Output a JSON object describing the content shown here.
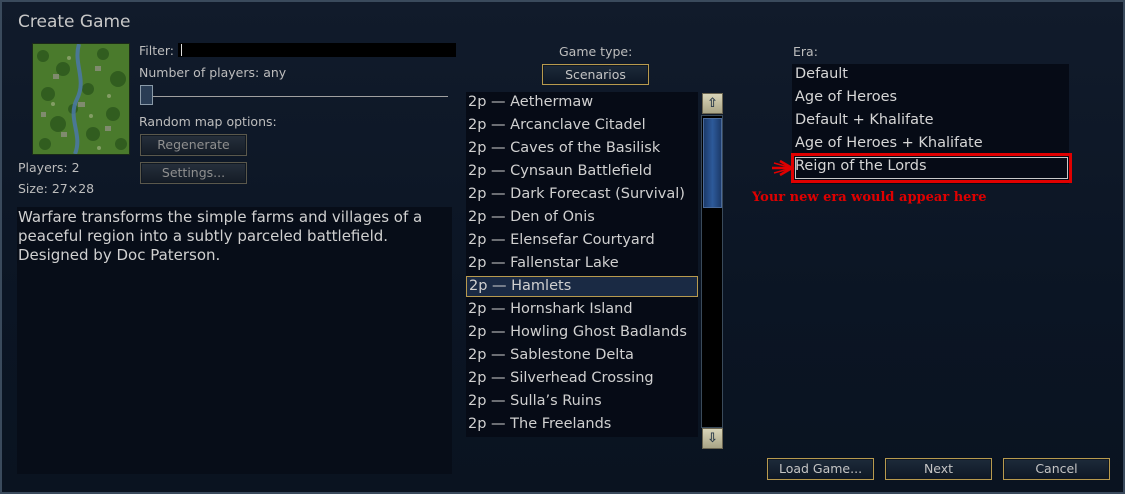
{
  "window": {
    "title": "Create Game"
  },
  "map_panel": {
    "filter_label": "Filter:",
    "num_players_label": "Number of players: any",
    "random_map_label": "Random map options:",
    "regenerate_label": "Regenerate",
    "settings_label": "Settings...",
    "players": "Players: 2",
    "size": "Size: 27×28",
    "description": "Warfare transforms the simple farms and villages of a peaceful region into a subtly parceled battlefield. Designed by Doc Paterson."
  },
  "game_type": {
    "label": "Game type:",
    "value": "Scenarios"
  },
  "scenarios": [
    "2p — Aethermaw",
    "2p — Arcanclave Citadel",
    "2p — Caves of the Basilisk",
    "2p — Cynsaun Battlefield",
    "2p — Dark Forecast (Survival)",
    "2p — Den of Onis",
    "2p — Elensefar Courtyard",
    "2p — Fallenstar Lake",
    "2p — Hamlets",
    "2p — Hornshark Island",
    "2p — Howling Ghost Badlands",
    "2p — Sablestone Delta",
    "2p — Silverhead Crossing",
    "2p — Sulla’s Ruins",
    "2p — The Freelands"
  ],
  "selected_scenario": "2p — Hamlets",
  "era": {
    "label": "Era:",
    "items": [
      "Default",
      "Age of Heroes",
      "Default + Khalifate",
      "Age of Heroes + Khalifate",
      "Reign of the Lords"
    ],
    "annotation": "Your new era would appear here",
    "annotation_color": "#e00000"
  },
  "buttons": {
    "load_game": "Load Game...",
    "next": "Next",
    "cancel": "Cancel"
  },
  "icons": {
    "scroll_up": "up-arrow-icon",
    "scroll_down": "down-arrow-icon",
    "annotation_arrow": "arrow-right-icon"
  },
  "colors": {
    "selection_border": "#b89a4e",
    "highlight": "#e00000"
  }
}
